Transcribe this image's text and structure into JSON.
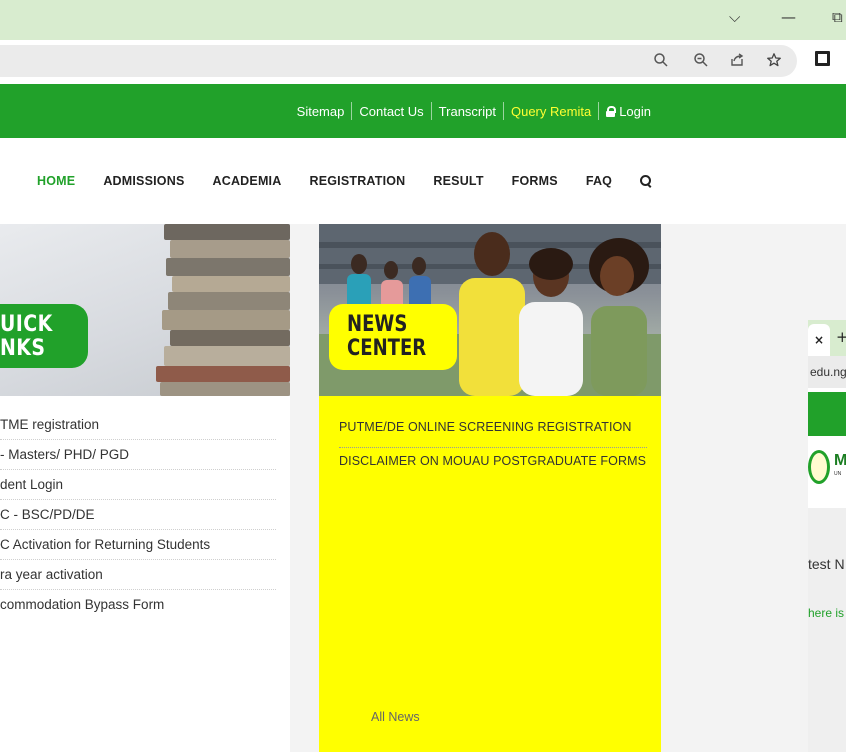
{
  "browser": {
    "window_controls": [
      "⌵",
      "—",
      "⧉"
    ],
    "toolbar_icons": [
      "search-icon",
      "zoom-out-icon",
      "share-icon",
      "star-icon",
      "sidebar-icon"
    ]
  },
  "topbar": {
    "links": [
      "Sitemap",
      "Contact Us",
      "Transcript",
      "Query Remita",
      "Login"
    ]
  },
  "nav": {
    "items": [
      "HOME",
      "ADMISSIONS",
      "ACADEMIA",
      "REGISTRATION",
      "RESULT",
      "FORMS",
      "FAQ"
    ]
  },
  "quick_links": {
    "tag_line1": "UICK",
    "tag_line2": "NKS",
    "items": [
      "TME registration",
      "- Masters/ PHD/ PGD",
      "dent Login",
      "C - BSC/PD/DE",
      "C Activation for Returning Students",
      "ra year activation",
      "commodation Bypass Form"
    ]
  },
  "news": {
    "tag_line1": "NEWS",
    "tag_line2": "CENTER",
    "items": [
      "PUTME/DE ONLINE SCREENING REGISTRATION",
      "DISCLAIMER ON MOUAU POSTGRADUATE FORMS"
    ],
    "all_news": "All News"
  },
  "mini_window": {
    "tab_close": "×",
    "tab_new": "+",
    "url_fragment": "edu.ng",
    "logo_letter": "M",
    "logo_sub": "UN",
    "latest_text": "test N",
    "there_text": "here is"
  },
  "colors": {
    "brand_green": "#21a12a",
    "news_yellow": "#ffff00",
    "remita_yellow": "#ffff33"
  }
}
